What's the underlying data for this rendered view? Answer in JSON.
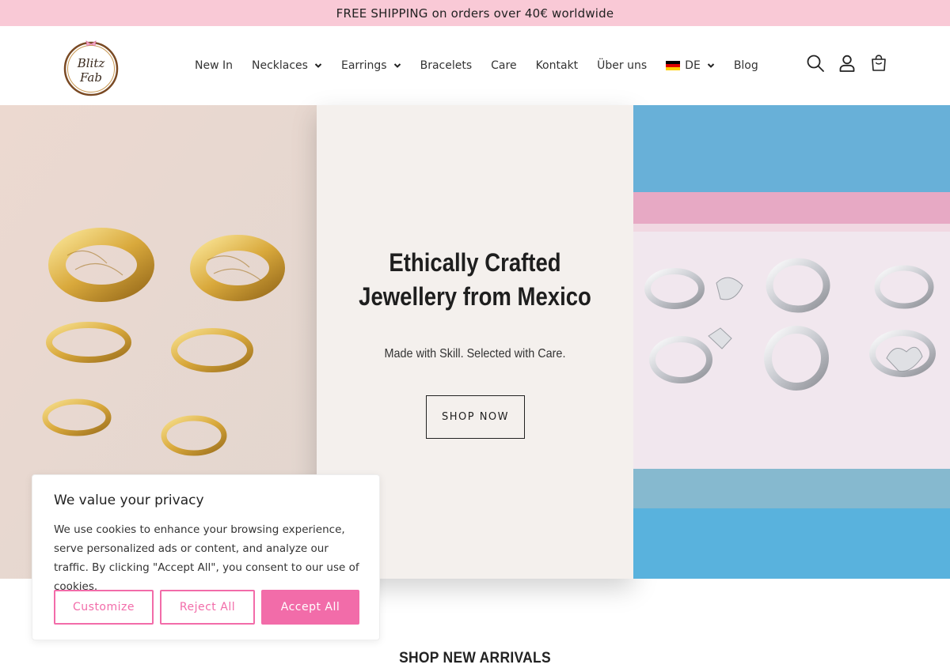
{
  "announcement": {
    "text": "FREE SHIPPING on orders over 40€ worldwide"
  },
  "logo": {
    "line1": "Blitz",
    "line2": "Fab"
  },
  "nav": {
    "items": [
      {
        "label": "New In",
        "has_dropdown": false
      },
      {
        "label": "Necklaces",
        "has_dropdown": true
      },
      {
        "label": "Earrings",
        "has_dropdown": true
      },
      {
        "label": "Bracelets",
        "has_dropdown": false
      },
      {
        "label": "Care",
        "has_dropdown": false
      },
      {
        "label": "Kontakt",
        "has_dropdown": false
      },
      {
        "label": "Über uns",
        "has_dropdown": false
      }
    ],
    "language": {
      "label": "DE",
      "flag": "germany-flag"
    },
    "blog": "Blog"
  },
  "header_icons": [
    "search-icon",
    "account-icon",
    "cart-icon"
  ],
  "hero": {
    "title_line1": "Ethically Crafted",
    "title_line2": "Jewellery from Mexico",
    "subtitle": "Made with Skill. Selected with Care.",
    "cta": "SHOP NOW"
  },
  "section": {
    "title": "SHOP NEW ARRIVALS"
  },
  "cookie": {
    "title": "We value your privacy",
    "body": "We use cookies to enhance your browsing experience, serve personalized ads or content, and analyze our traffic. By clicking \"Accept All\", you consent to our use of cookies.",
    "customize": "Customize",
    "reject": "Reject All",
    "accept": "Accept All"
  },
  "colors": {
    "announcement_bg": "#f9c9d6",
    "accent_pink": "#f26ca9",
    "hero_mid_bg": "#f4f0ed",
    "hero_left_bg": "#eadbd3",
    "hero_right_bg": "#6fb6dd"
  }
}
